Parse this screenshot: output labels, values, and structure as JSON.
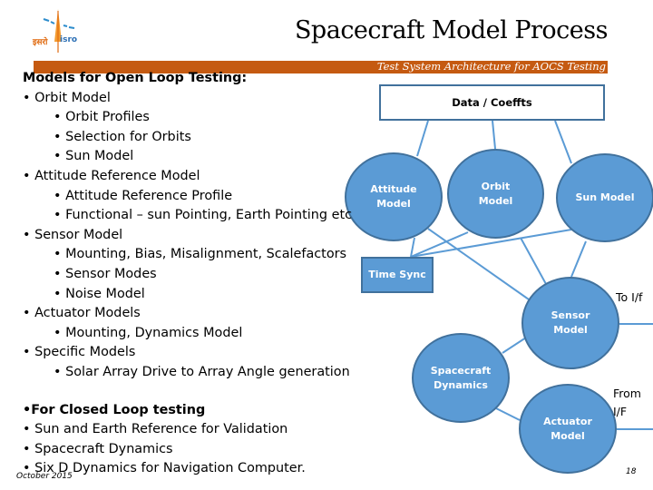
{
  "header": {
    "logo": {
      "icon": "isro-logo-icon",
      "text_hindi": "इसरो",
      "text_latin": "isro"
    },
    "title": "Spacecraft Model Process",
    "banner_text": "Test System Architecture for AOCS Testing"
  },
  "open_loop": {
    "heading": "Models for Open Loop Testing:",
    "items": [
      {
        "level": 1,
        "text": "• Orbit Model"
      },
      {
        "level": 2,
        "text": "• Orbit Profiles"
      },
      {
        "level": 2,
        "text": "• Selection for Orbits"
      },
      {
        "level": 2,
        "text": "• Sun Model"
      },
      {
        "level": 1,
        "text": "• Attitude Reference Model"
      },
      {
        "level": 2,
        "text": "• Attitude Reference Profile"
      },
      {
        "level": 2,
        "text": "• Functional – sun Pointing, Earth Pointing etc"
      },
      {
        "level": 1,
        "text": "• Sensor Model"
      },
      {
        "level": 2,
        "text": "• Mounting, Bias, Misalignment, Scalefactors"
      },
      {
        "level": 2,
        "text": "• Sensor Modes"
      },
      {
        "level": 2,
        "text": "• Noise Model"
      },
      {
        "level": 1,
        "text": "• Actuator Models"
      },
      {
        "level": 2,
        "text": "• Mounting, Dynamics Model"
      },
      {
        "level": 1,
        "text": "• Specific Models"
      },
      {
        "level": 2,
        "text": "• Solar Array Drive to Array Angle generation"
      }
    ]
  },
  "closed_loop": {
    "heading": "•For Closed Loop testing",
    "items": [
      "• Sun and Earth Reference for Validation",
      "• Spacecraft Dynamics",
      "• Six D Dynamics for Navigation Computer."
    ]
  },
  "diagram": {
    "data_box": "Data / Coeffts",
    "attitude": [
      "Attitude",
      "Model"
    ],
    "orbit": [
      "Orbit",
      "Model"
    ],
    "sun": "Sun Model",
    "time_sync": "Time Sync",
    "sensor": [
      "Sensor",
      "Model"
    ],
    "dynamics": [
      "Spacecraft",
      "Dynamics"
    ],
    "actuator": [
      "Actuator",
      "Model"
    ],
    "to_if": "To I/f",
    "from_if": [
      "From",
      "I/F"
    ],
    "colors": {
      "node_fill": "#5b9bd5",
      "node_border": "#41719c",
      "connector": "#5b9bd5",
      "banner": "#c55a11"
    }
  },
  "footer": {
    "date": "October 2015",
    "page_number": "18"
  }
}
